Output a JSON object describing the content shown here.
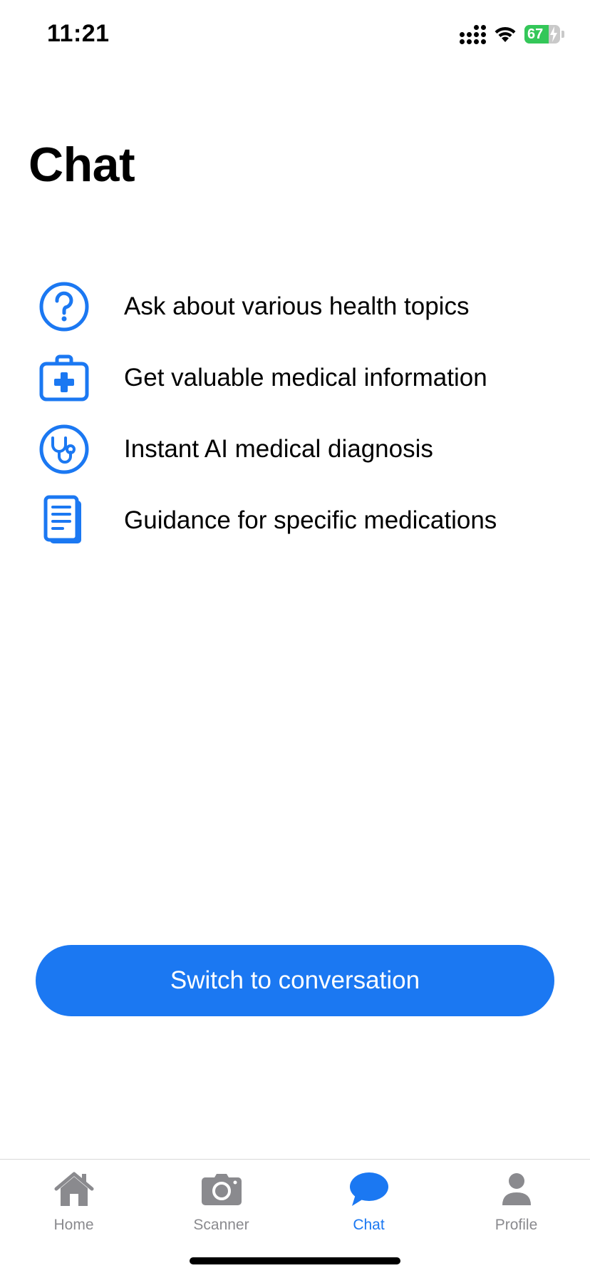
{
  "status_bar": {
    "time": "11:21",
    "battery_level": "67",
    "battery_charging": true
  },
  "page": {
    "title": "Chat"
  },
  "features": [
    {
      "icon": "question-circle-icon",
      "text": "Ask about various health topics"
    },
    {
      "icon": "medical-kit-icon",
      "text": "Get valuable medical information"
    },
    {
      "icon": "stethoscope-icon",
      "text": "Instant AI medical diagnosis"
    },
    {
      "icon": "document-icon",
      "text": "Guidance for specific medications"
    }
  ],
  "cta": {
    "label": "Switch to conversation"
  },
  "tab_bar": {
    "tabs": [
      {
        "icon": "home-icon",
        "label": "Home",
        "active": false
      },
      {
        "icon": "camera-icon",
        "label": "Scanner",
        "active": false
      },
      {
        "icon": "chat-bubble-icon",
        "label": "Chat",
        "active": true
      },
      {
        "icon": "person-icon",
        "label": "Profile",
        "active": false
      }
    ]
  },
  "colors": {
    "accent": "#1b78f2",
    "inactive_tab": "#8a8a8e",
    "battery_green": "#34c759"
  }
}
